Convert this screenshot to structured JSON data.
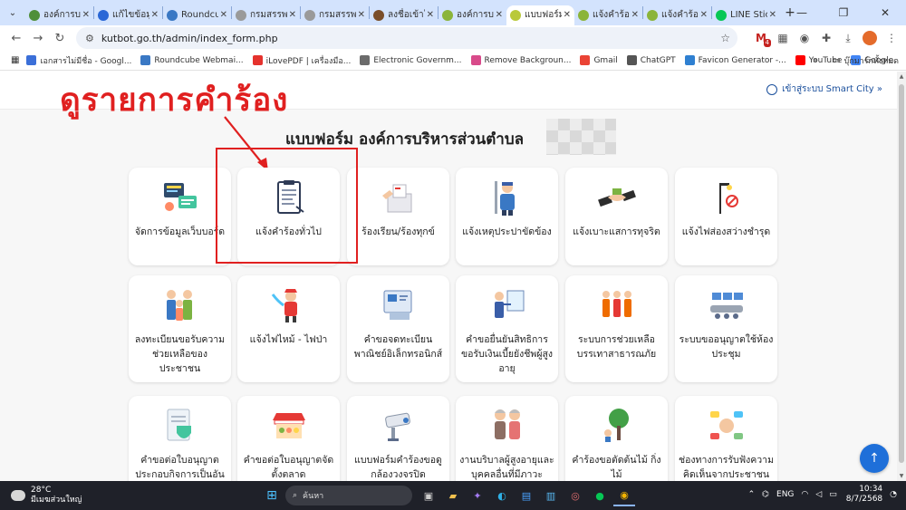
{
  "browser": {
    "tabs": [
      {
        "title": "องค์การบริ",
        "color": "#4f8f3a"
      },
      {
        "title": "แก้ไขข้อมู",
        "color": "#2a67d6"
      },
      {
        "title": "Roundcu",
        "color": "#3a78c4"
      },
      {
        "title": "กรมสรรพ",
        "color": "#9a9a9a"
      },
      {
        "title": "กรมสรรพ",
        "color": "#9a9a9a"
      },
      {
        "title": "ลงชื่อเข้าใ",
        "color": "#7a4e2a"
      },
      {
        "title": "องค์การบริ",
        "color": "#8bb43a"
      },
      {
        "title": "แบบฟอร์ม",
        "color": "#b9c93a",
        "active": true
      },
      {
        "title": "แจ้งคำร้อง",
        "color": "#8bb43a"
      },
      {
        "title": "แจ้งคำร้อง",
        "color": "#8bb43a"
      },
      {
        "title": "LINE Stic",
        "color": "#06c755"
      }
    ],
    "close_glyph": "✕",
    "url": "kutbot.go.th/admin/index_form.php",
    "gmail_badge": "4",
    "bookmarks": [
      {
        "label": "เอกสารไม่มีชื่อ - Googl...",
        "color": "#3b6fd8"
      },
      {
        "label": "Roundcube Webmai...",
        "color": "#3a78c4"
      },
      {
        "label": "iLovePDF | เครื่องมือ...",
        "color": "#e5322d"
      },
      {
        "label": "Electronic Governm...",
        "color": "#6b6b6b"
      },
      {
        "label": "Remove Backgroun...",
        "color": "#d84a8a"
      },
      {
        "label": "Gmail",
        "color": "#ea4335"
      },
      {
        "label": "ChatGPT",
        "color": "#555555"
      },
      {
        "label": "Favicon Generator -...",
        "color": "#2f80d1"
      },
      {
        "label": "YouTube",
        "color": "#ff0000"
      },
      {
        "label": "Google",
        "color": "#4285f4"
      }
    ],
    "bookmarks_more": "»",
    "bookmarks_folder": "บุ๊กมาร์กทั้งหมด"
  },
  "page": {
    "login_label": "เข้าสู่ระบบ Smart City »",
    "annotation": "ดูรายการคำร้อง",
    "title": "แบบฟอร์ม องค์การบริหารส่วนตำบล",
    "cards": [
      {
        "label": "จัดการข้อมูลเว็บบอร์ด",
        "icon": "webboard-icon"
      },
      {
        "label": "แจ้งคำร้องทั่วไป",
        "icon": "clipboard-form-icon"
      },
      {
        "label": "ร้องเรียน/ร้องทุกข์",
        "icon": "complaint-box-icon"
      },
      {
        "label": "แจ้งเหตุประปาขัดข้อง",
        "icon": "plumber-icon"
      },
      {
        "label": "แจ้งเบาะแสการทุจริต",
        "icon": "handshake-bribe-icon"
      },
      {
        "label": "แจ้งไฟส่องสว่างชำรุด",
        "icon": "street-light-icon"
      },
      {
        "label": "ลงทะเบียนขอรับความช่วยเหลือของประชาชน",
        "icon": "family-icon"
      },
      {
        "label": "แจ้งไฟไหม้ - ไฟป่า",
        "icon": "firefighter-icon"
      },
      {
        "label": "คำขอจดทะเบียนพาณิชย์อิเล็กทรอนิกส์",
        "icon": "registration-icon"
      },
      {
        "label": "คำขอยื่นยันสิทธิการขอรับเงินเบี้ยยังชีพผู้สูงอายุ",
        "icon": "elderly-allowance-icon"
      },
      {
        "label": "ระบบการช่วยเหลือบรรเทาสาธารณภัย",
        "icon": "rescue-team-icon"
      },
      {
        "label": "ระบบขออนุญาตใช้ห้องประชุม",
        "icon": "meeting-room-icon"
      },
      {
        "label": "คำขอต่อใบอนุญาตประกอบกิจการเป็นอัน",
        "icon": "license-doc-icon"
      },
      {
        "label": "คำขอต่อใบอนุญาตจัดตั้งตลาด",
        "icon": "market-stall-icon"
      },
      {
        "label": "แบบฟอร์มคำร้องขอดูกล้องวงจรปิด",
        "icon": "cctv-icon"
      },
      {
        "label": "งานบริบาลผู้สูงอายุและบุคคลอื่นที่มีภาวะ",
        "icon": "elderly-care-icon"
      },
      {
        "label": "คำร้องขอตัดต้นไม้ กิ่งไม้",
        "icon": "tree-cut-icon"
      },
      {
        "label": "ช่องทางการรับฟังความคิดเห็นจากประชาชน",
        "icon": "feedback-icon"
      }
    ],
    "fab_glyph": "↑"
  },
  "taskbar": {
    "temp": "28°C",
    "weather": "มีเมฆส่วนใหญ่",
    "search": "ค้นหา",
    "lang": "ENG",
    "time": "10:34",
    "date": "8/7/2568"
  }
}
